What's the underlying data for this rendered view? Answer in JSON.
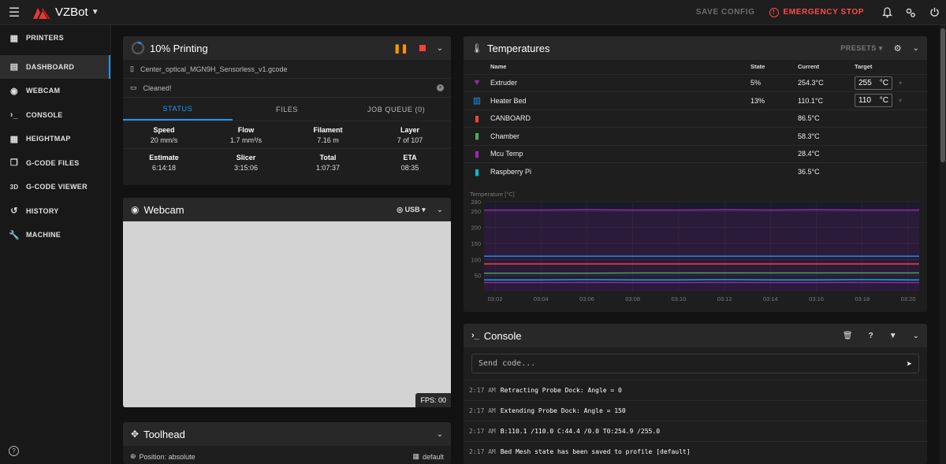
{
  "app": {
    "title": "VZBot",
    "save_config": "SAVE CONFIG",
    "emergency_stop": "EMERGENCY STOP"
  },
  "sidebar": {
    "items": [
      {
        "label": "PRINTERS",
        "icon": "printers-icon"
      },
      {
        "label": "DASHBOARD",
        "icon": "dashboard-icon"
      },
      {
        "label": "WEBCAM",
        "icon": "webcam-icon"
      },
      {
        "label": "CONSOLE",
        "icon": "console-icon"
      },
      {
        "label": "HEIGHTMAP",
        "icon": "grid-icon"
      },
      {
        "label": "G-CODE FILES",
        "icon": "files-icon"
      },
      {
        "label": "G-CODE VIEWER",
        "icon": "3d-icon"
      },
      {
        "label": "HISTORY",
        "icon": "history-icon"
      },
      {
        "label": "MACHINE",
        "icon": "wrench-icon"
      }
    ],
    "icon_3d": "3D"
  },
  "printing": {
    "title": "10% Printing",
    "progress": 0.1,
    "filename": "Center_optical_MGN9H_Sensorless_v1.gcode",
    "message": "Cleaned!",
    "tabs": [
      "STATUS",
      "FILES",
      "JOB QUEUE (0)"
    ],
    "stats_row1": [
      {
        "k": "Speed",
        "v": "20 mm/s"
      },
      {
        "k": "Flow",
        "v": "1.7 mm³/s"
      },
      {
        "k": "Filament",
        "v": "7.16 m"
      },
      {
        "k": "Layer",
        "v": "7 of 107"
      }
    ],
    "stats_row2": [
      {
        "k": "Estimate",
        "v": "6:14:18"
      },
      {
        "k": "Slicer",
        "v": "3:15:06"
      },
      {
        "k": "Total",
        "v": "1:07:37"
      },
      {
        "k": "ETA",
        "v": "08:35"
      }
    ]
  },
  "webcam": {
    "title": "Webcam",
    "source": "USB",
    "fps": "FPS: 00"
  },
  "toolhead": {
    "title": "Toolhead",
    "position": "Position: absolute",
    "mode": "default"
  },
  "temperatures": {
    "title": "Temperatures",
    "presets": "PRESETS",
    "headers": {
      "name": "Name",
      "state": "State",
      "current": "Current",
      "target": "Target"
    },
    "unit": "°C",
    "rows": [
      {
        "name": "Extruder",
        "state": "5%",
        "current": "254.3°C",
        "target": "255",
        "color": "#9c27b0",
        "icon": "extruder-icon"
      },
      {
        "name": "Heater Bed",
        "state": "13%",
        "current": "110.1°C",
        "target": "110",
        "color": "#2196f3",
        "icon": "heater-bed-icon"
      },
      {
        "name": "CANBOARD",
        "state": "",
        "current": "86.5°C",
        "target": "",
        "color": "#f44336",
        "icon": "thermometer-icon"
      },
      {
        "name": "Chamber",
        "state": "",
        "current": "58.3°C",
        "target": "",
        "color": "#4caf50",
        "icon": "thermometer-icon"
      },
      {
        "name": "Mcu Temp",
        "state": "",
        "current": "28.4°C",
        "target": "",
        "color": "#9c27b0",
        "icon": "thermometer-icon"
      },
      {
        "name": "Raspberry Pi",
        "state": "",
        "current": "36.5°C",
        "target": "",
        "color": "#00bcd4",
        "icon": "thermometer-icon"
      }
    ]
  },
  "chart_data": {
    "type": "line",
    "ylabel": "Temperature [°C]",
    "ylim": [
      0,
      280
    ],
    "yticks": [
      50,
      100,
      150,
      200,
      250,
      280
    ],
    "xticks": [
      "03:02",
      "03:04",
      "03:06",
      "03:08",
      "03:10",
      "03:12",
      "03:14",
      "03:16",
      "03:18",
      "03:20"
    ],
    "grid": true,
    "series": [
      {
        "name": "Extruder",
        "color": "#9c27b0",
        "values": [
          254,
          254,
          255,
          254,
          254,
          255,
          254,
          255,
          254,
          254
        ]
      },
      {
        "name": "Heater Bed",
        "color": "#2196f3",
        "values": [
          110,
          110,
          110,
          110,
          110,
          110,
          110,
          110,
          110,
          110
        ]
      },
      {
        "name": "CANBOARD",
        "color": "#f44336",
        "values": [
          86,
          86,
          86,
          86,
          86,
          86,
          86,
          86,
          86,
          86
        ]
      },
      {
        "name": "Chamber",
        "color": "#4caf50",
        "values": [
          57,
          57,
          57,
          58,
          58,
          58,
          58,
          58,
          58,
          58
        ]
      },
      {
        "name": "Mcu Temp",
        "color": "#9c27b0",
        "values": [
          28,
          28,
          28,
          28,
          28,
          28,
          28,
          28,
          28,
          28
        ]
      },
      {
        "name": "Raspberry Pi",
        "color": "#00bcd4",
        "values": [
          36,
          36,
          37,
          36,
          36,
          37,
          36,
          36,
          37,
          36
        ]
      }
    ]
  },
  "console": {
    "title": "Console",
    "placeholder": "Send code...",
    "lines": [
      {
        "time": "2:17 AM",
        "text": "Retracting Probe Dock: Angle = 0"
      },
      {
        "time": "2:17 AM",
        "text": "Extending Probe Dock: Angle = 150"
      },
      {
        "time": "2:17 AM",
        "text": "B:110.1 /110.0 C:44.4 /0.0 T0:254.9 /255.0"
      },
      {
        "time": "2:17 AM",
        "text": "Bed Mesh state has been saved to profile [default]"
      }
    ]
  }
}
